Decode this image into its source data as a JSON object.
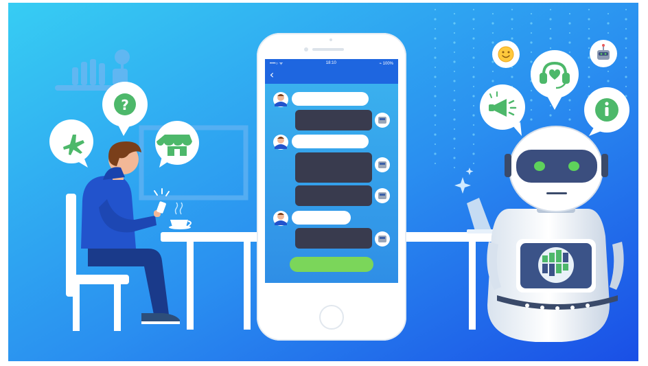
{
  "phone": {
    "status": {
      "carrier": "••••○ ᯤ",
      "time": "18:10",
      "battery": "⌁ 100%"
    },
    "back_icon": "chevron-left-icon",
    "action_button_label": ""
  },
  "colors": {
    "bg_light": "#35c6f0",
    "bg_dark": "#1f5ee8",
    "phone_header": "#1e66e0",
    "chat_area": "#3aa4ea",
    "user_bubble": "#ffffff",
    "bot_bubble": "#393b4e",
    "action_button": "#7bd65a",
    "bubble_white": "#ffffff",
    "icon_green": "#4db86a",
    "robot_eye": "#5ed25b"
  },
  "icons": {
    "left_bubbles": [
      "airplane-icon",
      "question-icon",
      "store-icon"
    ],
    "right_bubbles": [
      "smile-emoji-icon",
      "robot-face-icon",
      "megaphone-icon",
      "support-heart-icon",
      "info-icon"
    ]
  }
}
